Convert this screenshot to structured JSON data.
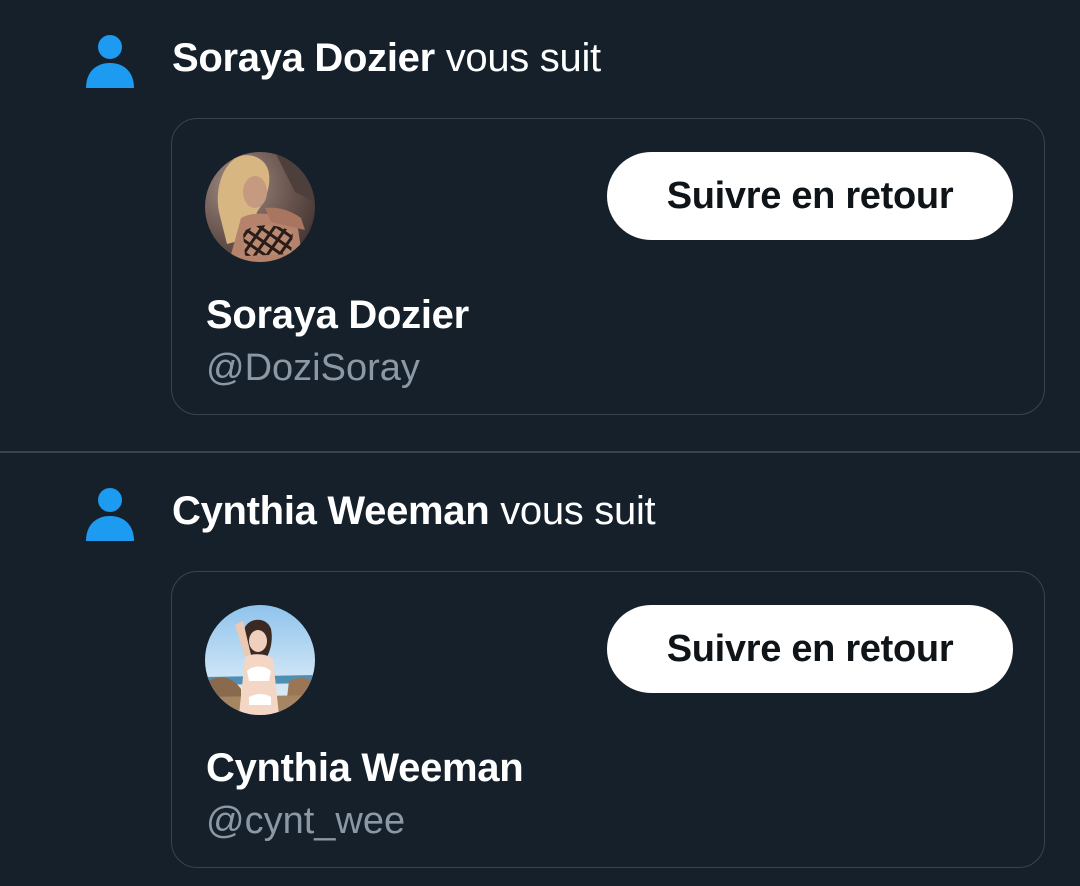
{
  "colors": {
    "background": "#15202b",
    "accent_icon": "#1d9bf0",
    "card_border": "#38444d",
    "secondary_text": "#8b98a5",
    "button_bg": "#ffffff",
    "button_text": "#0f1419"
  },
  "notifications": [
    {
      "icon": "person-icon",
      "actor_name": "Soraya Dozier",
      "action_text": " vous suit",
      "card": {
        "display_name": "Soraya Dozier",
        "handle": "@DoziSoray",
        "follow_button_label": "Suivre en retour"
      }
    },
    {
      "icon": "person-icon",
      "actor_name": "Cynthia Weeman",
      "action_text": " vous suit",
      "card": {
        "display_name": "Cynthia Weeman",
        "handle": "@cynt_wee",
        "follow_button_label": "Suivre en retour"
      }
    }
  ]
}
